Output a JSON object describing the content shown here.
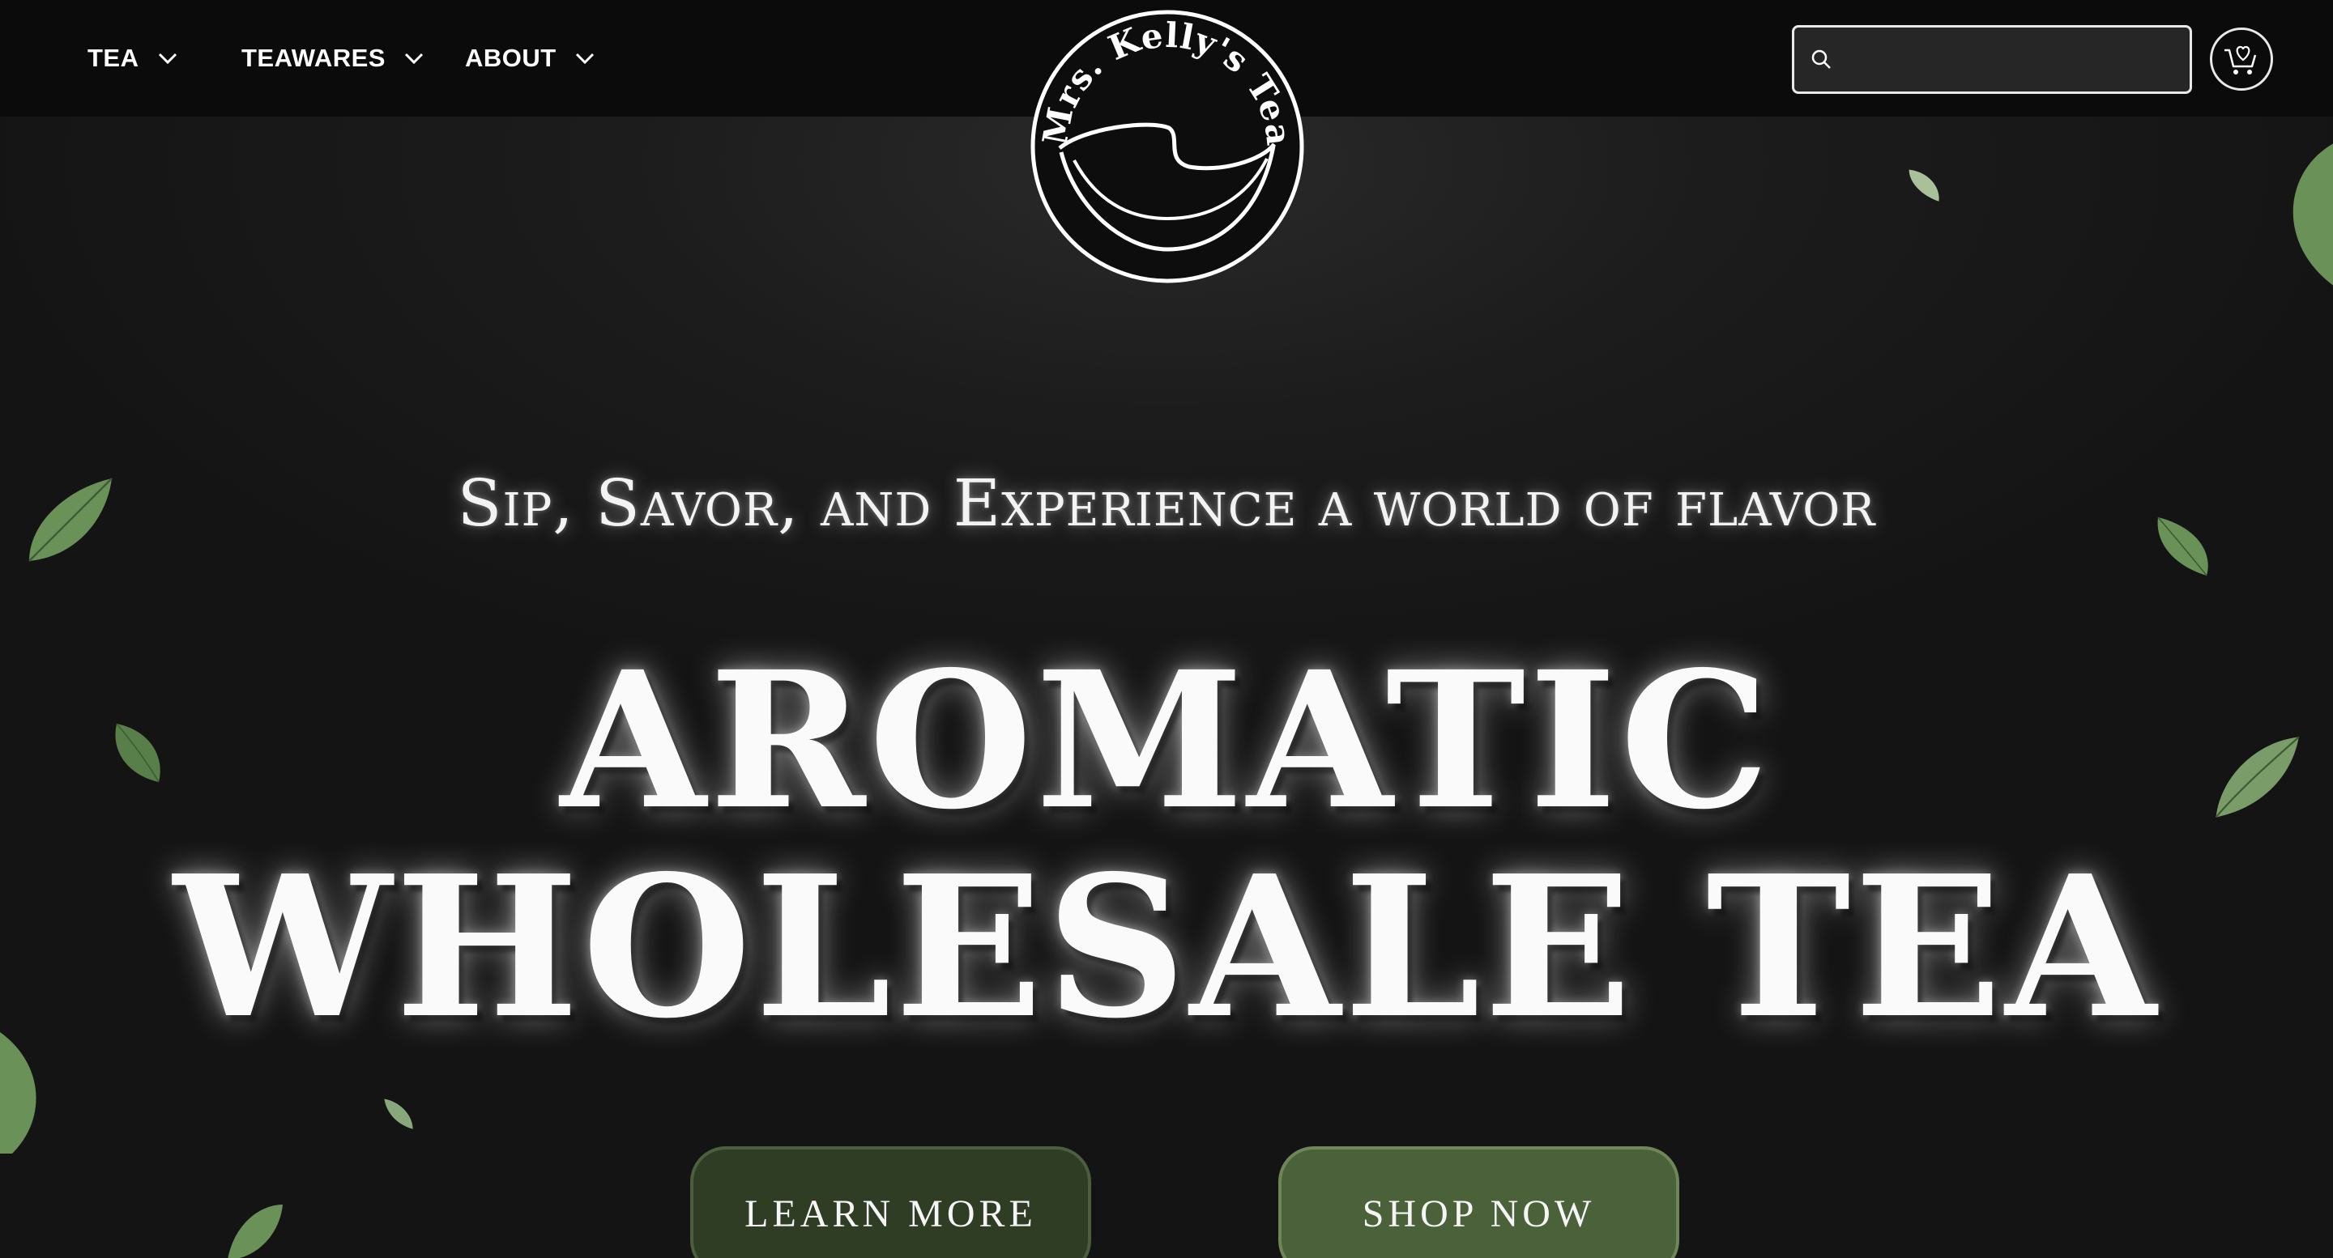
{
  "nav": {
    "items": [
      {
        "label": "TEA"
      },
      {
        "label": "TEAWARES"
      },
      {
        "label": "ABOUT"
      }
    ]
  },
  "logo": {
    "text": "Mrs. Kelly's Tea"
  },
  "search": {
    "placeholder": "",
    "value": ""
  },
  "cart": {
    "icon": "cart-heart-icon"
  },
  "hero": {
    "tagline": "Sip, Savor, and Experience a world of flavor",
    "headline_line1": "AROMATIC",
    "headline_line2": "WHOLESALE TEA"
  },
  "buttons": {
    "learn_more": "LEARN MORE",
    "shop_now": "SHOP NOW"
  },
  "colors": {
    "background": "#161616",
    "header": "#0b0b0b",
    "learn_button": "#2f3d25",
    "shop_button": "#4b613a",
    "leaf": "#5f8a4f"
  }
}
